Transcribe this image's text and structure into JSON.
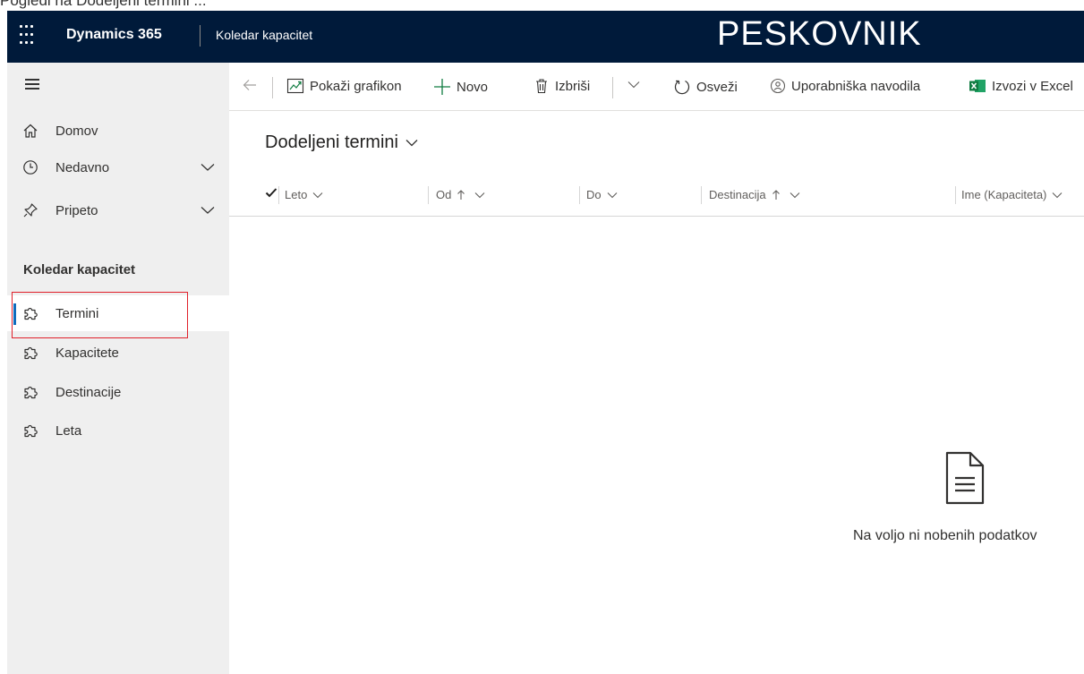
{
  "top_strip_text": "Pogledi na Dodeljeni termini ...",
  "header": {
    "app_name": "Dynamics 365",
    "area_name": "Koledar kapacitet",
    "environment": "PESKOVNIK"
  },
  "sidebar": {
    "home_label": "Domov",
    "recent_label": "Nedavno",
    "pinned_label": "Pripeto",
    "group_title": "Koledar kapacitet",
    "items": [
      {
        "label": "Termini",
        "active": true
      },
      {
        "label": "Kapacitete"
      },
      {
        "label": "Destinacije"
      },
      {
        "label": "Leta"
      }
    ]
  },
  "commands": {
    "show_chart": "Pokaži grafikon",
    "new": "Novo",
    "delete": "Izbriši",
    "refresh": "Osveži",
    "user_guide": "Uporabniška navodila",
    "export_excel": "Izvozi v Excel"
  },
  "view": {
    "title": "Dodeljeni termini"
  },
  "grid": {
    "columns": [
      {
        "label": "Leto"
      },
      {
        "label": "Od"
      },
      {
        "label": "Do"
      },
      {
        "label": "Destinacija"
      },
      {
        "label": "Ime (Kapaciteta)"
      }
    ],
    "empty_message": "Na voljo ni nobenih podatkov"
  },
  "colors": {
    "header_bg": "#001a3a",
    "sidebar_bg": "#efefef",
    "accent": "#0f6cbd",
    "highlight": "#e0202a"
  }
}
